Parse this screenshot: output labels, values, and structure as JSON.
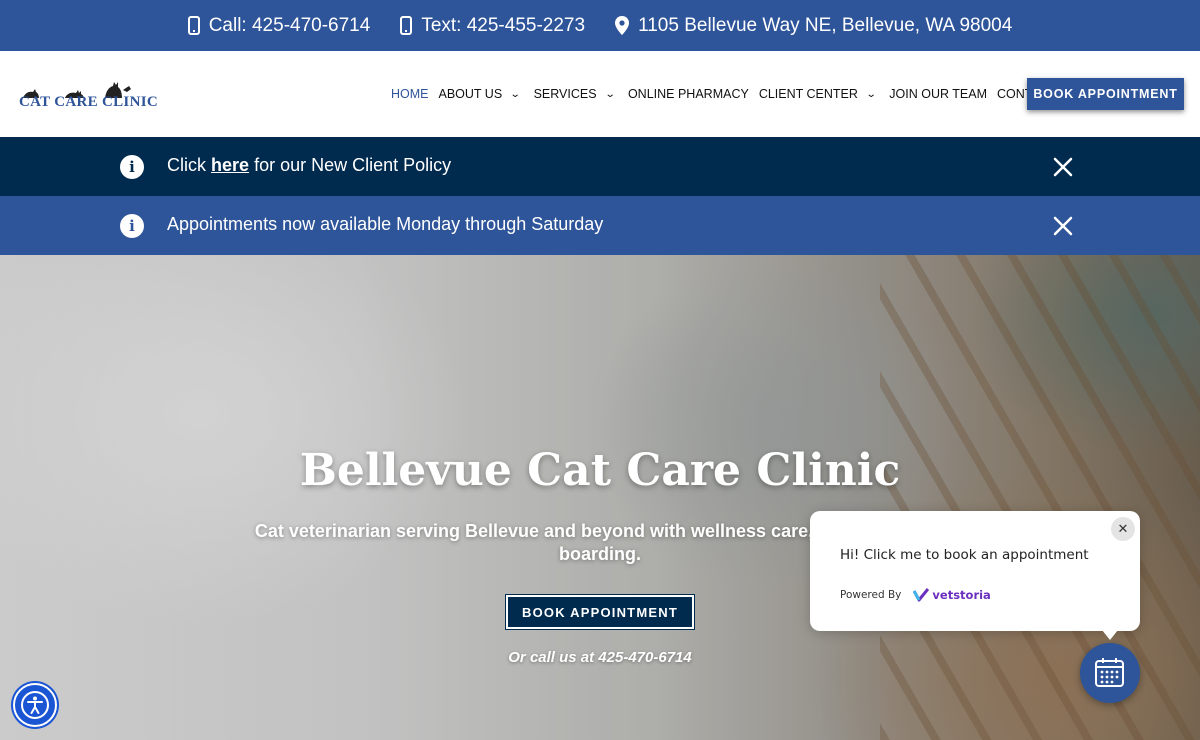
{
  "topbar": {
    "call": "Call: 425-470-6714",
    "text": "Text: 425-455-2273",
    "address": "1105 Bellevue Way NE, Bellevue, WA 98004"
  },
  "header": {
    "logo_text": "CAT CARE CLINIC",
    "nav": [
      {
        "label": "HOME",
        "active": true
      },
      {
        "label": "ABOUT US",
        "dropdown": true
      },
      {
        "label": "SERVICES",
        "dropdown": true
      },
      {
        "label": "ONLINE PHARMACY"
      },
      {
        "label": "CLIENT CENTER",
        "dropdown": true
      },
      {
        "label": "JOIN OUR TEAM"
      },
      {
        "label": "CONTACT"
      }
    ],
    "book_label": "BOOK APPOINTMENT"
  },
  "alerts": {
    "policy_prefix": "Click",
    "policy_link": "here",
    "policy_suffix": "for our New Client Policy",
    "appointments": "Appointments now available Monday through Saturday"
  },
  "hero": {
    "title": "Bellevue Cat Care Clinic",
    "subtitle": "Cat veterinarian serving Bellevue and beyond with wellness care, pet dental, and boarding.",
    "book_label": "BOOK APPOINTMENT",
    "call_text": "Or call us at 425-470-6714"
  },
  "popup": {
    "message": "Hi! Click me to book an appointment",
    "powered_by": "Powered By",
    "brand": "vetstoria"
  },
  "colors": {
    "brand_blue": "#2e5499",
    "navy": "#002b4e",
    "accessibility_blue": "#1a55d4",
    "vetstoria_purple": "#6b2fbf"
  }
}
